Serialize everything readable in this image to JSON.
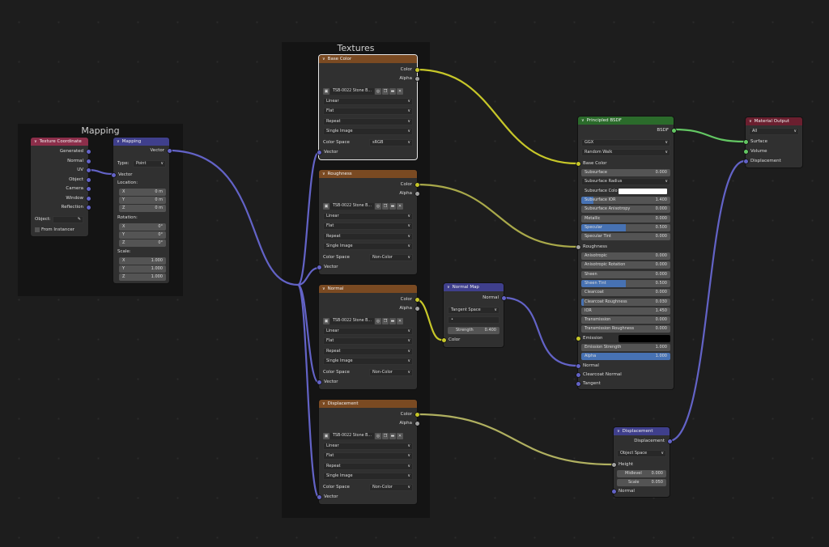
{
  "frames": {
    "mapping_title": "Mapping",
    "textures_title": "Textures"
  },
  "tex_coord": {
    "title": "Texture Coordinate",
    "outputs": [
      "Generated",
      "Normal",
      "UV",
      "Object",
      "Camera",
      "Window",
      "Reflection"
    ],
    "object_label": "Object:",
    "from_instancer": "From Instancer"
  },
  "mapping": {
    "title": "Mapping",
    "output": "Vector",
    "type_label": "Type:",
    "type_value": "Point",
    "vector_input": "Vector",
    "location_label": "Location:",
    "location": [
      {
        "axis": "X",
        "value": "0 m"
      },
      {
        "axis": "Y",
        "value": "0 m"
      },
      {
        "axis": "Z",
        "value": "0 m"
      }
    ],
    "rotation_label": "Rotation:",
    "rotation": [
      {
        "axis": "X",
        "value": "0°"
      },
      {
        "axis": "Y",
        "value": "0°"
      },
      {
        "axis": "Z",
        "value": "0°"
      }
    ],
    "scale_label": "Scale:",
    "scale": [
      {
        "axis": "X",
        "value": "1.000"
      },
      {
        "axis": "Y",
        "value": "1.000"
      },
      {
        "axis": "Z",
        "value": "1.000"
      }
    ]
  },
  "textures": [
    {
      "title": "Base Color",
      "image": "TSB-0022 Stone B...",
      "color_space": "sRGB"
    },
    {
      "title": "Roughness",
      "image": "TSB-0022 Stone B...",
      "color_space": "Non-Color"
    },
    {
      "title": "Normal",
      "image": "TSB-0022 Stone B...",
      "color_space": "Non-Color"
    },
    {
      "title": "Displacement",
      "image": "TSB-0022 Stone B...",
      "color_space": "Non-Color"
    }
  ],
  "tex_common": {
    "color_out": "Color",
    "alpha_out": "Alpha",
    "interpolation": "Linear",
    "projection": "Flat",
    "extension": "Repeat",
    "source": "Single Image",
    "color_space_label": "Color Space",
    "vector_in": "Vector"
  },
  "normal_map": {
    "title": "Normal Map",
    "output": "Normal",
    "space": "Tangent Space",
    "uv_value": "•",
    "strength_label": "Strength",
    "strength_value": "0.400",
    "color_in": "Color"
  },
  "bsdf": {
    "title": "Principled BSDF",
    "output": "BSDF",
    "distribution": "GGX",
    "subsurface_method": "Random Walk",
    "base_color": "Base Color",
    "rows": [
      {
        "label": "Subsurface",
        "value": "0.000",
        "fill": 0
      },
      {
        "label": "Subsurface Radius",
        "value": "",
        "fill": 0,
        "dropdown": true
      },
      {
        "label": "Subsurface Colo",
        "value": "",
        "fill": 0,
        "swatch": "#ffffff"
      },
      {
        "label": "Subsurface IOR",
        "value": "1.400",
        "fill": 0.14
      },
      {
        "label": "Subsurface Anisotropy",
        "value": "0.000",
        "fill": 0
      },
      {
        "label": "Metallic",
        "value": "0.000",
        "fill": 0
      },
      {
        "label": "Specular",
        "value": "0.500",
        "fill": 0.5
      },
      {
        "label": "Specular Tint",
        "value": "0.000",
        "fill": 0
      }
    ],
    "roughness_label": "Roughness",
    "rows2": [
      {
        "label": "Anisotropic",
        "value": "0.000",
        "fill": 0
      },
      {
        "label": "Anisotropic Rotation",
        "value": "0.000",
        "fill": 0
      },
      {
        "label": "Sheen",
        "value": "0.000",
        "fill": 0
      },
      {
        "label": "Sheen Tint",
        "value": "0.500",
        "fill": 0.5
      },
      {
        "label": "Clearcoat",
        "value": "0.000",
        "fill": 0
      },
      {
        "label": "Clearcoat Roughness",
        "value": "0.030",
        "fill": 0.03
      },
      {
        "label": "IOR",
        "value": "1.450",
        "fill": 0
      },
      {
        "label": "Transmission",
        "value": "0.000",
        "fill": 0
      },
      {
        "label": "Transmission Roughness",
        "value": "0.000",
        "fill": 0
      }
    ],
    "emission_label": "Emission",
    "emission_color": "#000000",
    "emission_strength_label": "Emission Strength",
    "emission_strength_value": "1.000",
    "alpha_label": "Alpha",
    "alpha_value": "1.000",
    "normal_label": "Normal",
    "clearcoat_normal_label": "Clearcoat Normal",
    "tangent_label": "Tangent"
  },
  "material_output": {
    "title": "Material Output",
    "target": "All",
    "surface": "Surface",
    "volume": "Volume",
    "displacement": "Displacement"
  },
  "displacement": {
    "title": "Displacement",
    "output": "Displacement",
    "space": "Object Space",
    "height": "Height",
    "midlevel_label": "Midlevel",
    "midlevel_value": "0.000",
    "scale_label": "Scale",
    "scale_value": "0.050",
    "normal": "Normal"
  },
  "colors": {
    "color_socket": "#c7c729",
    "float_socket": "#a1a1a1",
    "vector_socket": "#6363c7",
    "shader_socket": "#63c763",
    "texture_header": "#7a4a22",
    "shader_header": "#2b6b2b",
    "output_header": "#6b1f2f"
  }
}
